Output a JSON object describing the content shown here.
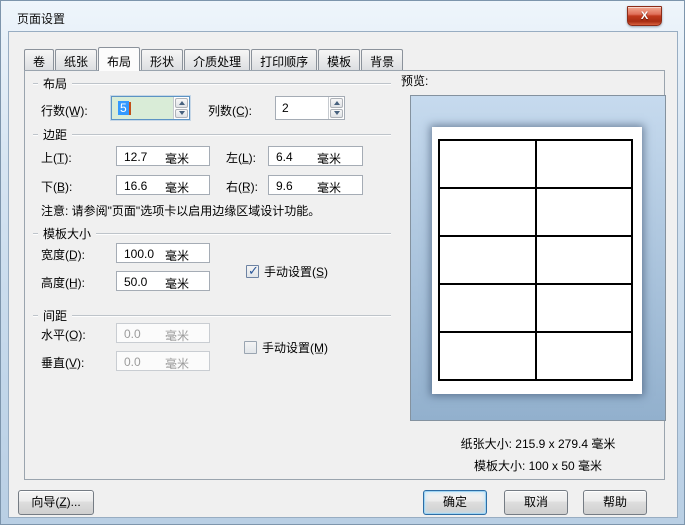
{
  "window": {
    "title": "页面设置",
    "close_glyph": "X"
  },
  "tabs": {
    "active_index": 2,
    "items": [
      "卷",
      "纸张",
      "布局",
      "形状",
      "介质处理",
      "打印顺序",
      "模板",
      "背景"
    ]
  },
  "layout_group": {
    "title": "布局",
    "rows_label": "行数(W̲):",
    "rows_value": "5",
    "cols_label": "列数(C̲):",
    "cols_value": "2"
  },
  "margins_group": {
    "title": "边距",
    "top_label": "上(T̲):",
    "top_value": "12.7",
    "bottom_label": "下(B̲):",
    "bottom_value": "16.6",
    "left_label": "左(L̲):",
    "left_value": "6.4",
    "right_label": "右(R̲):",
    "right_value": "9.6",
    "unit": "毫米"
  },
  "note": "注意: 请参阅\"页面\"选项卡以启用边缘区域设计功能。",
  "template_group": {
    "title": "模板大小",
    "width_label": "宽度(D̲):",
    "width_value": "100.0",
    "height_label": "高度(H̲):",
    "height_value": "50.0",
    "unit": "毫米",
    "manual_label": "手动设置(S̲)",
    "manual_checked": true
  },
  "spacing_group": {
    "title": "间距",
    "horizontal_label": "水平(O̲):",
    "horizontal_value": "0.0",
    "vertical_label": "垂直(V̲):",
    "vertical_value": "0.0",
    "unit": "毫米",
    "manual_label": "手动设置(M̲)",
    "manual_checked": false
  },
  "preview": {
    "label": "预览:",
    "rows": 5,
    "cols": 2,
    "paper_size_text": "纸张大小: 215.9 x 279.4 毫米",
    "template_size_text": "模板大小: 100 x 50 毫米"
  },
  "footer": {
    "wizard_label": "向导(Z̲)...",
    "ok_label": "确定",
    "cancel_label": "取消",
    "help_label": "帮助"
  },
  "icons": {
    "checkmark": "✓"
  },
  "colors": {
    "focus_field_bg": "#d9ecd7",
    "selection_bg": "#3399ff",
    "preview_bg_top": "#c6daee",
    "preview_bg_bottom": "#92b0cd",
    "close_button_red": "#c0391d"
  }
}
